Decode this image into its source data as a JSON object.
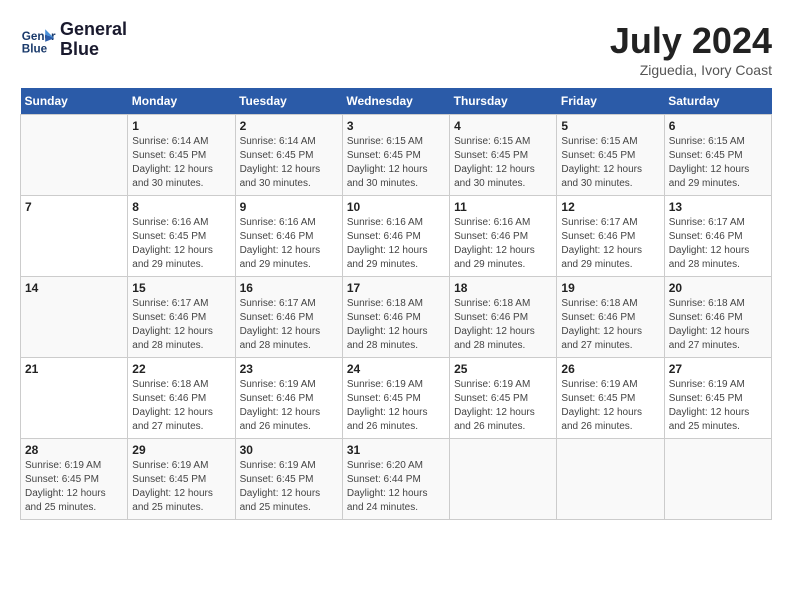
{
  "header": {
    "logo_line1": "General",
    "logo_line2": "Blue",
    "month_year": "July 2024",
    "location": "Ziguedia, Ivory Coast"
  },
  "days_of_week": [
    "Sunday",
    "Monday",
    "Tuesday",
    "Wednesday",
    "Thursday",
    "Friday",
    "Saturday"
  ],
  "weeks": [
    [
      {
        "day": "",
        "info": ""
      },
      {
        "day": "1",
        "info": "Sunrise: 6:14 AM\nSunset: 6:45 PM\nDaylight: 12 hours\nand 30 minutes."
      },
      {
        "day": "2",
        "info": "Sunrise: 6:14 AM\nSunset: 6:45 PM\nDaylight: 12 hours\nand 30 minutes."
      },
      {
        "day": "3",
        "info": "Sunrise: 6:15 AM\nSunset: 6:45 PM\nDaylight: 12 hours\nand 30 minutes."
      },
      {
        "day": "4",
        "info": "Sunrise: 6:15 AM\nSunset: 6:45 PM\nDaylight: 12 hours\nand 30 minutes."
      },
      {
        "day": "5",
        "info": "Sunrise: 6:15 AM\nSunset: 6:45 PM\nDaylight: 12 hours\nand 30 minutes."
      },
      {
        "day": "6",
        "info": "Sunrise: 6:15 AM\nSunset: 6:45 PM\nDaylight: 12 hours\nand 29 minutes."
      }
    ],
    [
      {
        "day": "7",
        "info": ""
      },
      {
        "day": "8",
        "info": "Sunrise: 6:16 AM\nSunset: 6:45 PM\nDaylight: 12 hours\nand 29 minutes."
      },
      {
        "day": "9",
        "info": "Sunrise: 6:16 AM\nSunset: 6:46 PM\nDaylight: 12 hours\nand 29 minutes."
      },
      {
        "day": "10",
        "info": "Sunrise: 6:16 AM\nSunset: 6:46 PM\nDaylight: 12 hours\nand 29 minutes."
      },
      {
        "day": "11",
        "info": "Sunrise: 6:16 AM\nSunset: 6:46 PM\nDaylight: 12 hours\nand 29 minutes."
      },
      {
        "day": "12",
        "info": "Sunrise: 6:17 AM\nSunset: 6:46 PM\nDaylight: 12 hours\nand 29 minutes."
      },
      {
        "day": "13",
        "info": "Sunrise: 6:17 AM\nSunset: 6:46 PM\nDaylight: 12 hours\nand 28 minutes."
      }
    ],
    [
      {
        "day": "14",
        "info": ""
      },
      {
        "day": "15",
        "info": "Sunrise: 6:17 AM\nSunset: 6:46 PM\nDaylight: 12 hours\nand 28 minutes."
      },
      {
        "day": "16",
        "info": "Sunrise: 6:17 AM\nSunset: 6:46 PM\nDaylight: 12 hours\nand 28 minutes."
      },
      {
        "day": "17",
        "info": "Sunrise: 6:18 AM\nSunset: 6:46 PM\nDaylight: 12 hours\nand 28 minutes."
      },
      {
        "day": "18",
        "info": "Sunrise: 6:18 AM\nSunset: 6:46 PM\nDaylight: 12 hours\nand 28 minutes."
      },
      {
        "day": "19",
        "info": "Sunrise: 6:18 AM\nSunset: 6:46 PM\nDaylight: 12 hours\nand 27 minutes."
      },
      {
        "day": "20",
        "info": "Sunrise: 6:18 AM\nSunset: 6:46 PM\nDaylight: 12 hours\nand 27 minutes."
      }
    ],
    [
      {
        "day": "21",
        "info": ""
      },
      {
        "day": "22",
        "info": "Sunrise: 6:18 AM\nSunset: 6:46 PM\nDaylight: 12 hours\nand 27 minutes."
      },
      {
        "day": "23",
        "info": "Sunrise: 6:19 AM\nSunset: 6:46 PM\nDaylight: 12 hours\nand 26 minutes."
      },
      {
        "day": "24",
        "info": "Sunrise: 6:19 AM\nSunset: 6:45 PM\nDaylight: 12 hours\nand 26 minutes."
      },
      {
        "day": "25",
        "info": "Sunrise: 6:19 AM\nSunset: 6:45 PM\nDaylight: 12 hours\nand 26 minutes."
      },
      {
        "day": "26",
        "info": "Sunrise: 6:19 AM\nSunset: 6:45 PM\nDaylight: 12 hours\nand 26 minutes."
      },
      {
        "day": "27",
        "info": "Sunrise: 6:19 AM\nSunset: 6:45 PM\nDaylight: 12 hours\nand 25 minutes."
      }
    ],
    [
      {
        "day": "28",
        "info": "Sunrise: 6:19 AM\nSunset: 6:45 PM\nDaylight: 12 hours\nand 25 minutes."
      },
      {
        "day": "29",
        "info": "Sunrise: 6:19 AM\nSunset: 6:45 PM\nDaylight: 12 hours\nand 25 minutes."
      },
      {
        "day": "30",
        "info": "Sunrise: 6:19 AM\nSunset: 6:45 PM\nDaylight: 12 hours\nand 25 minutes."
      },
      {
        "day": "31",
        "info": "Sunrise: 6:20 AM\nSunset: 6:44 PM\nDaylight: 12 hours\nand 24 minutes."
      },
      {
        "day": "",
        "info": ""
      },
      {
        "day": "",
        "info": ""
      },
      {
        "day": "",
        "info": ""
      }
    ]
  ]
}
